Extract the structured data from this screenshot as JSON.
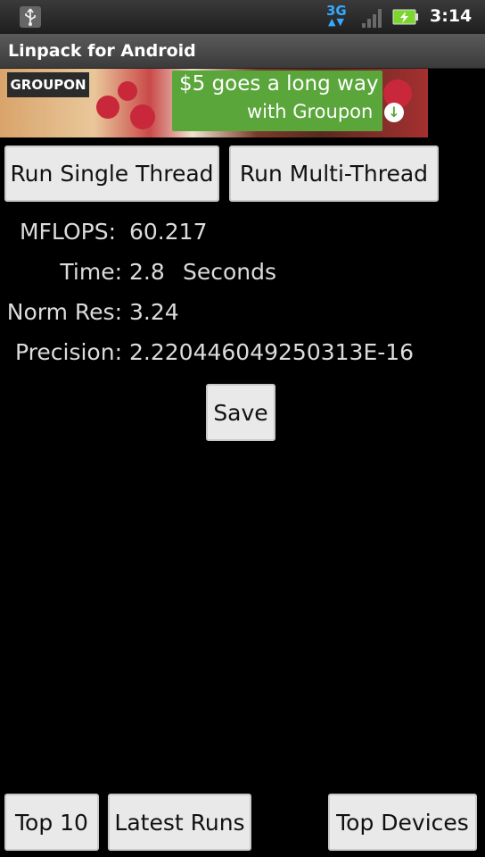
{
  "status_bar": {
    "network_type": "3G",
    "time": "3:14",
    "icons": [
      "usb-icon",
      "network-3g-icon",
      "signal-strength-icon",
      "battery-charging-icon"
    ],
    "colors": {
      "network_accent": "#33aaff",
      "battery_fill": "#7cd62f"
    }
  },
  "app": {
    "title": "Linpack for Android"
  },
  "ad": {
    "brand": "GROUPON",
    "line1": "$5 goes a long way",
    "line2": "with Groupon",
    "accent_color": "#5aa63a"
  },
  "actions": {
    "single_thread": "Run Single Thread",
    "multi_thread": "Run Multi-Thread",
    "save": "Save"
  },
  "results": {
    "mflops_label": "MFLOPS:",
    "mflops_value": "60.217",
    "time_label": "Time:",
    "time_value": "2.8",
    "time_unit": "Seconds",
    "norm_res_label": "Norm Res:",
    "norm_res_value": "3.24",
    "precision_label": "Precision:",
    "precision_value": "2.220446049250313E-16"
  },
  "bottom_nav": {
    "top10": "Top 10",
    "latest_runs": "Latest Runs",
    "top_devices": "Top Devices"
  }
}
